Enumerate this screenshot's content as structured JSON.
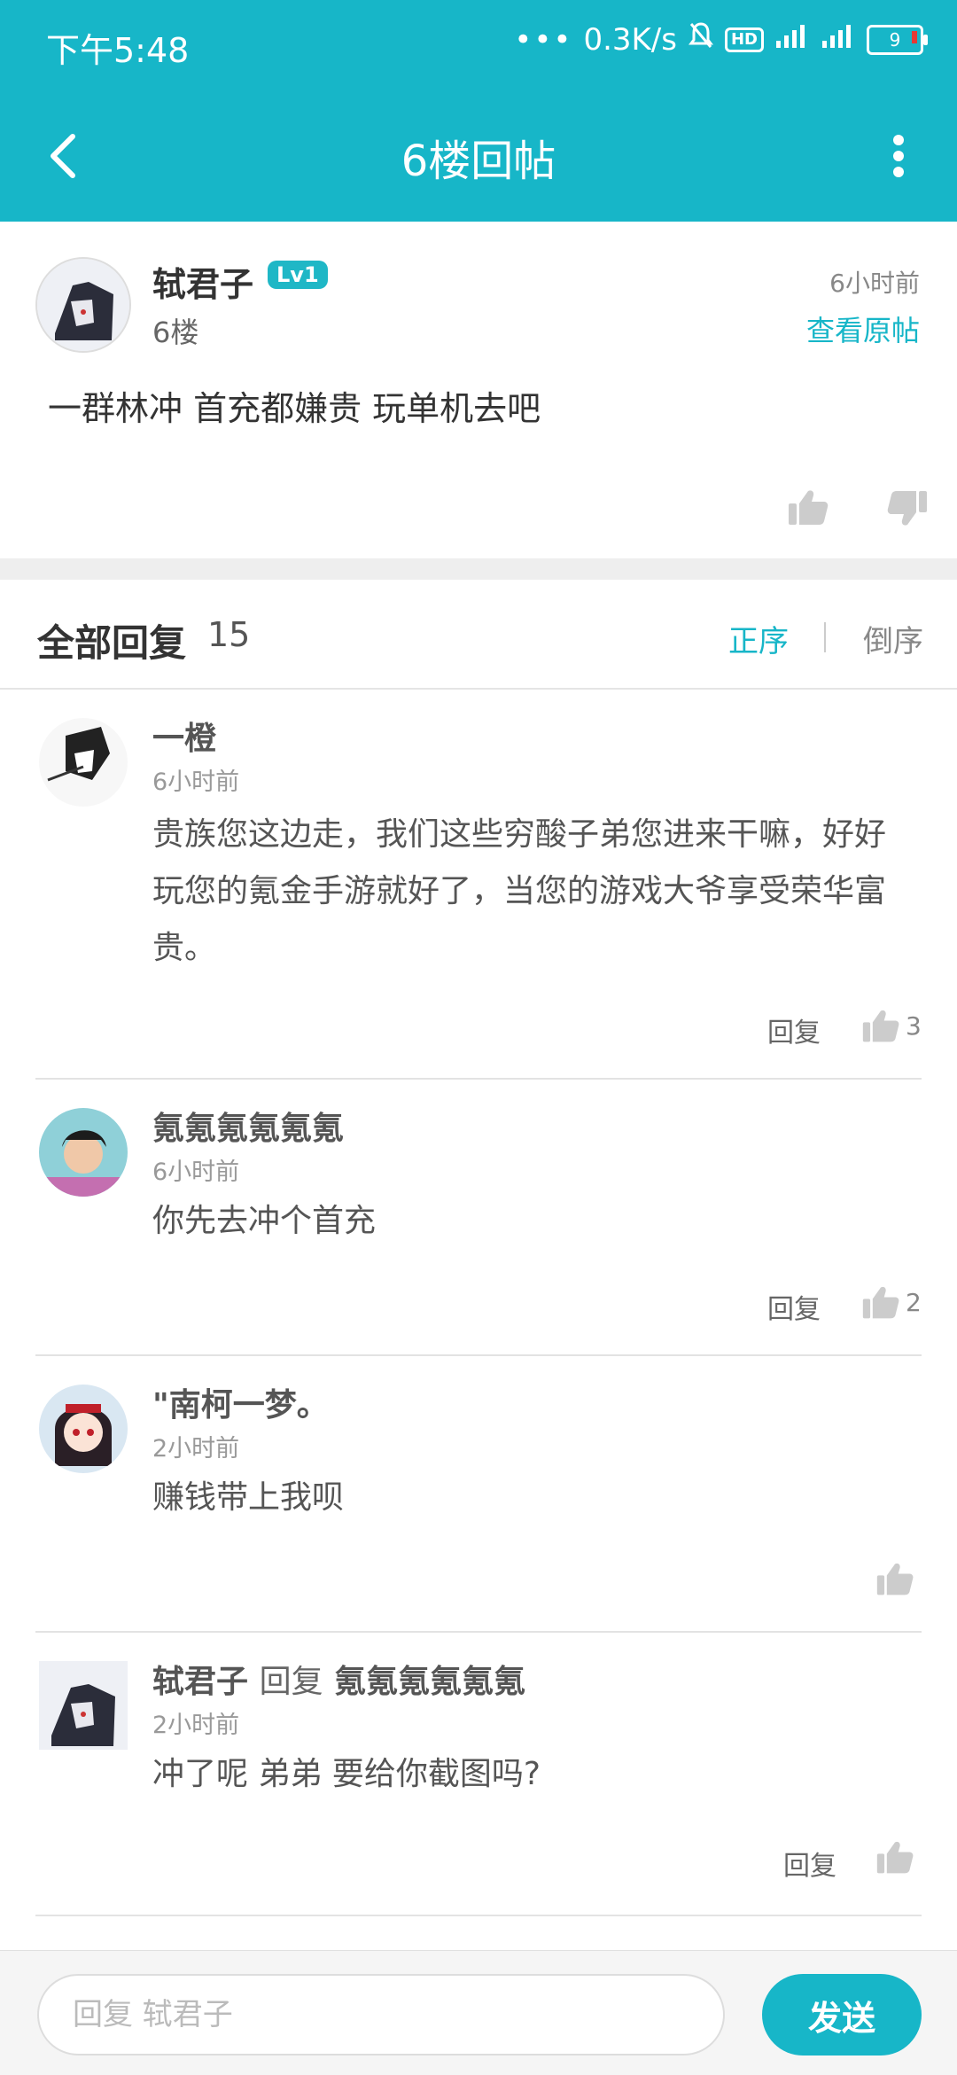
{
  "status_bar": {
    "time": "下午5:48",
    "net_speed": "0.3K/s",
    "hd_label": "HD",
    "battery": "9"
  },
  "header": {
    "title": "6楼回帖"
  },
  "post": {
    "author": "轼君子",
    "level": "Lv1",
    "floor": "6楼",
    "time": "6小时前",
    "view_original": "查看原帖",
    "content": "一群林冲 首充都嫌贵 玩单机去吧"
  },
  "replies_section": {
    "title": "全部回复",
    "count": "15",
    "sort_asc": "正序",
    "sort_desc": "倒序"
  },
  "replies": [
    {
      "name": "一橙",
      "time": "6小时前",
      "text": "贵族您这边走，我们这些穷酸子弟您进来干嘛，好好玩您的氪金手游就好了，当您的游戏大爷享受荣华富贵。",
      "reply_label": "回复",
      "likes": "3"
    },
    {
      "name": "氪氪氪氪氪氪",
      "time": "6小时前",
      "text": "你先去冲个首充",
      "reply_label": "回复",
      "likes": "2"
    },
    {
      "name": "\"南柯一梦。",
      "time": "2小时前",
      "text": "赚钱带上我呗"
    },
    {
      "name": "轼君子",
      "reply_word": "回复",
      "reply_to": "氪氪氪氪氪氪",
      "time": "2小时前",
      "text": "冲了呢 弟弟 要给你截图吗?",
      "reply_label": "回复"
    }
  ],
  "bottom_bar": {
    "placeholder": "回复 轼君子",
    "send_label": "发送"
  },
  "colors": {
    "accent": "#17b6c8"
  }
}
